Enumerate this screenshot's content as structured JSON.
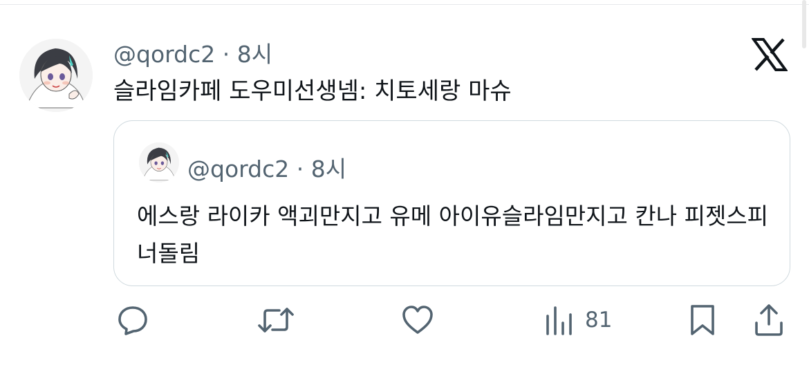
{
  "tweet": {
    "handle": "@qordc2",
    "separator": "·",
    "time": "8시",
    "text": "슬라임카페 도우미선생넴: 치토세랑 마슈"
  },
  "quote": {
    "handle": "@qordc2",
    "separator": "·",
    "time": "8시",
    "text": "에스랑 라이카 액괴만지고 유메 아이유슬라임만지고 칸나 피젯스피너돌림"
  },
  "actions": {
    "reply_icon": "reply-icon",
    "retweet_icon": "retweet-icon",
    "like_icon": "heart-icon",
    "views_icon": "views-icon",
    "views_count": "81",
    "bookmark_icon": "bookmark-icon",
    "share_icon": "share-icon"
  },
  "brand": {
    "logo": "x-logo-icon"
  },
  "colors": {
    "text_primary": "#0f1419",
    "text_secondary": "#536471",
    "border": "#cfd9de"
  }
}
